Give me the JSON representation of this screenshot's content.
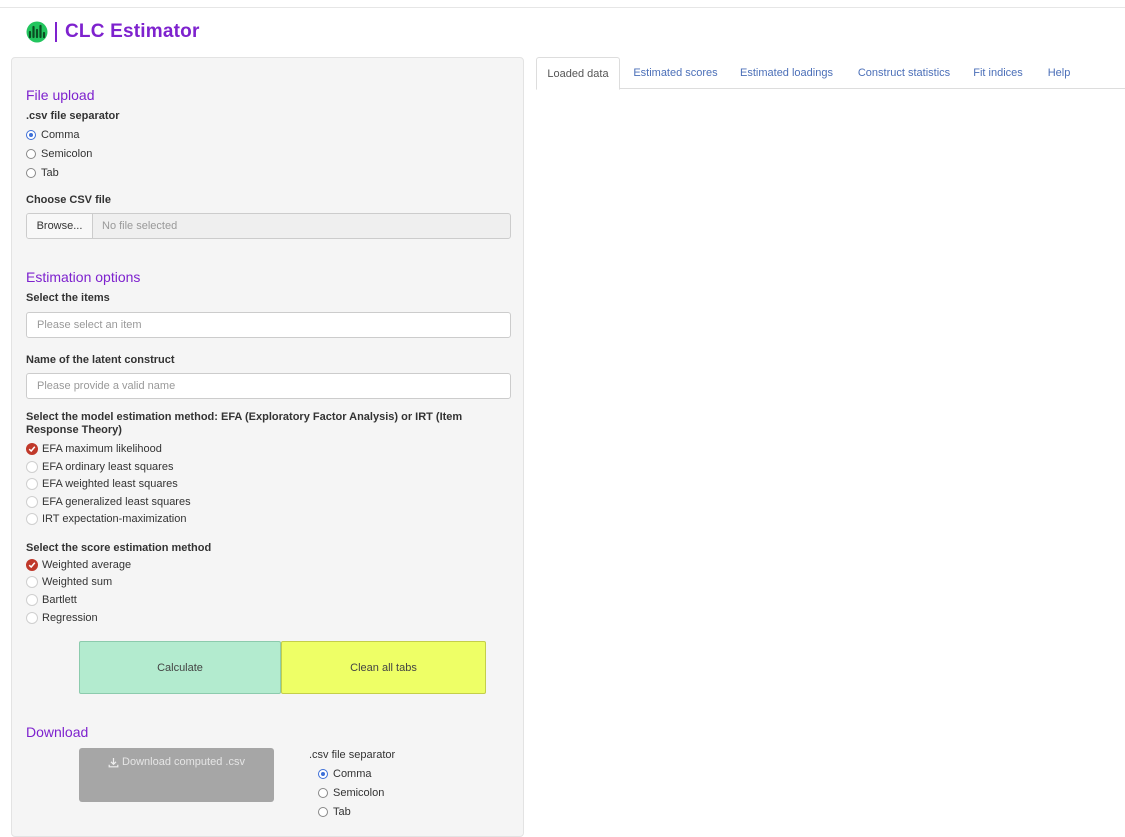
{
  "app": {
    "title": "CLC Estimator",
    "logo_icon": "bar-chart-circle-icon",
    "brand_color": "#7e22ce"
  },
  "file_upload": {
    "title": "File upload",
    "separator_label": ".csv file separator",
    "separator_options": [
      "Comma",
      "Semicolon",
      "Tab"
    ],
    "separator_selected": "Comma",
    "choose_label": "Choose CSV file",
    "browse_label": "Browse...",
    "file_status": "No file selected"
  },
  "estimation": {
    "title": "Estimation options",
    "items_label": "Select the items",
    "items_placeholder": "Please select an item",
    "construct_label": "Name of the latent construct",
    "construct_placeholder": "Please provide a valid name",
    "model_label": "Select the model estimation method: EFA (Exploratory Factor Analysis) or IRT (Item Response Theory)",
    "model_options": [
      "EFA maximum likelihood",
      "EFA ordinary least squares",
      "EFA weighted least squares",
      "EFA generalized least squares",
      "IRT expectation-maximization"
    ],
    "model_selected": "EFA maximum likelihood",
    "score_label": "Select the score estimation method",
    "score_options": [
      "Weighted average",
      "Weighted sum",
      "Bartlett",
      "Regression"
    ],
    "score_selected": "Weighted average",
    "check_color": "#c0392b"
  },
  "actions": {
    "calculate_label": "Calculate",
    "clean_label": "Clean all tabs",
    "calculate_color": "#b3ebcf",
    "clean_color": "#eeff66"
  },
  "download": {
    "title": "Download",
    "button_label": "Download computed .csv",
    "button_icon": "download-icon",
    "separator_label": ".csv file separator",
    "separator_options": [
      "Comma",
      "Semicolon",
      "Tab"
    ],
    "separator_selected": "Comma"
  },
  "tabs": [
    "Loaded data",
    "Estimated scores",
    "Estimated loadings",
    "Construct statistics",
    "Fit indices",
    "Help"
  ],
  "active_tab": "Loaded data"
}
